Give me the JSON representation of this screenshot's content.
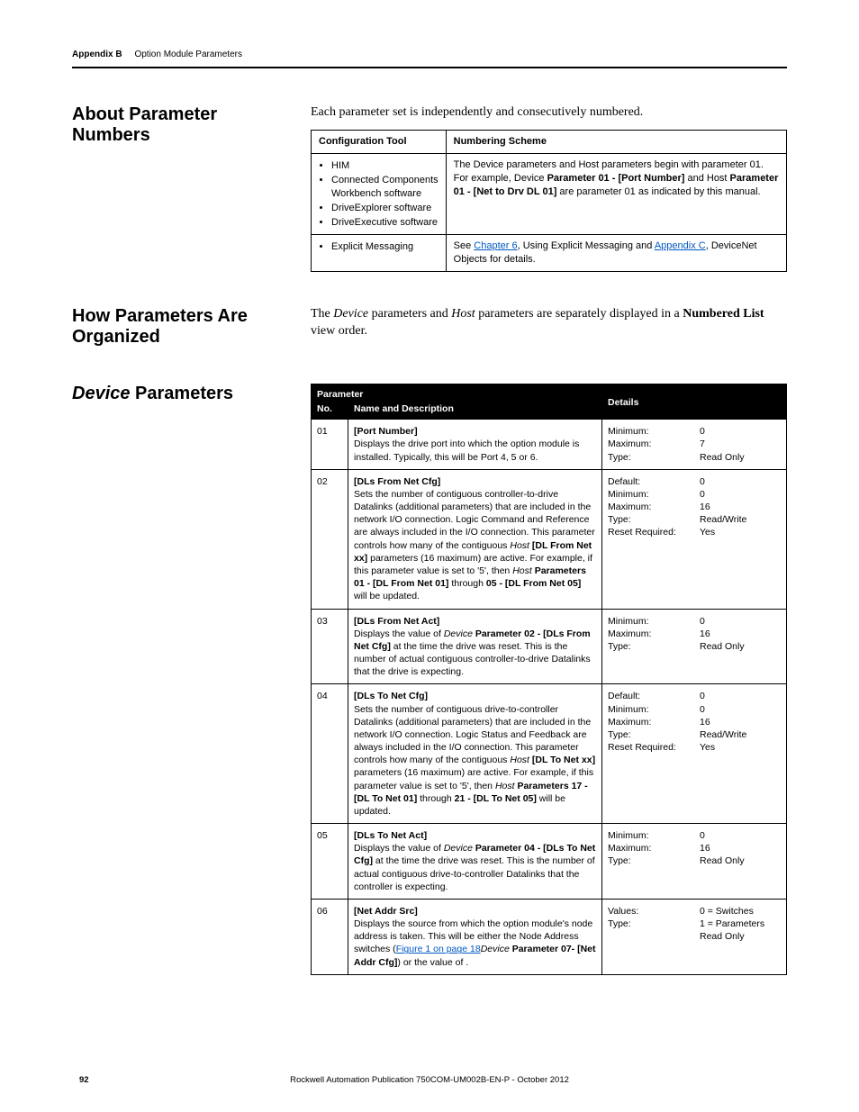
{
  "running_head": {
    "appendix": "Appendix B",
    "title": "Option Module Parameters"
  },
  "sec_about": {
    "heading": "About Parameter Numbers",
    "intro": "Each parameter set is independently and consecutively numbered.",
    "tbl": {
      "h1": "Configuration Tool",
      "h2": "Numbering Scheme",
      "r1c1_items": [
        "HIM",
        "Connected Components Workbench software",
        "DriveExplorer software",
        "DriveExecutive software"
      ],
      "r1c2_pre": "The ",
      "r1c2_i1": "Device",
      "r1c2_mid1": " parameters and ",
      "r1c2_i2": "Host",
      "r1c2_mid2": " parameters begin with parameter 01. For example, ",
      "r1c2_i3": "Device",
      "r1c2_b1": " Parameter 01 - [Port Number]",
      "r1c2_mid3": " and ",
      "r1c2_i4": "Host",
      "r1c2_b2": " Parameter 01 - [Net to Drv DL 01]",
      "r1c2_post": " are parameter 01 as indicated by this manual.",
      "r2c1_items": [
        "Explicit Messaging"
      ],
      "r2c2_pre": "See ",
      "r2c2_link1": "Chapter 6",
      "r2c2_mid": ", Using Explicit Messaging and ",
      "r2c2_link2": "Appendix C",
      "r2c2_post": ", DeviceNet Objects for details."
    }
  },
  "sec_how": {
    "heading": "How Parameters Are Organized",
    "p_pre": "The ",
    "p_i1": "Device",
    "p_mid1": " parameters and ",
    "p_i2": "Host",
    "p_mid2": " parameters are separately displayed in a ",
    "p_b": "Numbered List",
    "p_post": " view order."
  },
  "sec_dev": {
    "heading_i": "Device",
    "heading_r": " Parameters",
    "th_param": "Parameter",
    "th_no": "No.",
    "th_name": "Name and Description",
    "th_details": "Details",
    "rows": [
      {
        "no": "01",
        "name": "[Port Number]",
        "desc": "Displays the drive port into which the option module is installed. Typically, this will be Port 4, 5 or 6.",
        "labels": [
          "Minimum:",
          "Maximum:",
          "Type:"
        ],
        "values": [
          "0",
          "7",
          "Read Only"
        ]
      },
      {
        "no": "02",
        "name": "[DLs From Net Cfg]",
        "desc_parts": {
          "a": "Sets the number of contiguous controller-to-drive Datalinks (additional parameters) that are included in the network I/O connection. Logic Command and Reference are always included in the I/O connection. This parameter controls how many of the contiguous ",
          "i1": "Host",
          "b1": " [DL From Net xx]",
          "b": " parameters (16 maximum) are active. For example, if this parameter value is set to '5', then ",
          "i2": "Host",
          "b2": " Parameters 01 - [DL From Net 01]",
          "c": " through ",
          "b3": "05 - [DL From Net 05]",
          "d": " will be updated."
        },
        "labels": [
          "Default:",
          "Minimum:",
          "Maximum:",
          "Type:",
          "Reset Required:"
        ],
        "values": [
          "0",
          "0",
          "16",
          "Read/Write",
          "Yes"
        ]
      },
      {
        "no": "03",
        "name": "[DLs From Net Act]",
        "desc_parts": {
          "a": "Displays the value of ",
          "i1": "Device",
          "b1": " Parameter 02 - [DLs From Net Cfg]",
          "b": " at the time the drive was reset. This is the number of actual contiguous controller-to-drive Datalinks that the drive is expecting."
        },
        "labels": [
          "Minimum:",
          "Maximum:",
          "Type:"
        ],
        "values": [
          "0",
          "16",
          "Read Only"
        ]
      },
      {
        "no": "04",
        "name": "[DLs To Net Cfg]",
        "desc_parts": {
          "a": "Sets the number of contiguous drive-to-controller Datalinks (additional parameters) that are included in the network I/O connection. Logic Status and Feedback are always included in the I/O connection. This parameter controls how many of the contiguous ",
          "i1": "Host",
          "b1": " [DL To Net xx]",
          "b": " parameters (16 maximum) are active. For example, if this parameter value is set to '5', then ",
          "i2": "Host",
          "b2": " Parameters 17 - [DL To Net 01]",
          "c": " through ",
          "b3": "21 - [DL To Net 05]",
          "d": " will be updated."
        },
        "labels": [
          "Default:",
          "Minimum:",
          "Maximum:",
          "Type:",
          "Reset Required:"
        ],
        "values": [
          "0",
          "0",
          "16",
          "Read/Write",
          "Yes"
        ]
      },
      {
        "no": "05",
        "name": "[DLs To Net Act]",
        "desc_parts": {
          "a": "Displays the value of ",
          "i1": "Device",
          "b1": " Parameter 04 - [DLs To Net Cfg]",
          "b": " at the time the drive was reset. This is the number of actual contiguous drive-to-controller Datalinks that the controller is expecting."
        },
        "labels": [
          "Minimum:",
          "Maximum:",
          "Type:"
        ],
        "values": [
          "0",
          "16",
          "Read Only"
        ]
      },
      {
        "no": "06",
        "name": "[Net Addr Src]",
        "desc_parts": {
          "a": "Displays the source from which the option module's node address is taken. This will be either the Node Address switches (",
          "link": "Figure 1 on page 18",
          "b": ") or the value of ",
          "i1": "Device",
          "b1": " Parameter 07- [Net Addr Cfg]",
          "c": "."
        },
        "labels": [
          "Values:",
          "",
          "Type:"
        ],
        "values": [
          "0 = Switches",
          "1 = Parameters",
          "Read Only"
        ]
      }
    ]
  },
  "footer": {
    "page": "92",
    "pub": "Rockwell Automation Publication 750COM-UM002B-EN-P - October 2012"
  }
}
